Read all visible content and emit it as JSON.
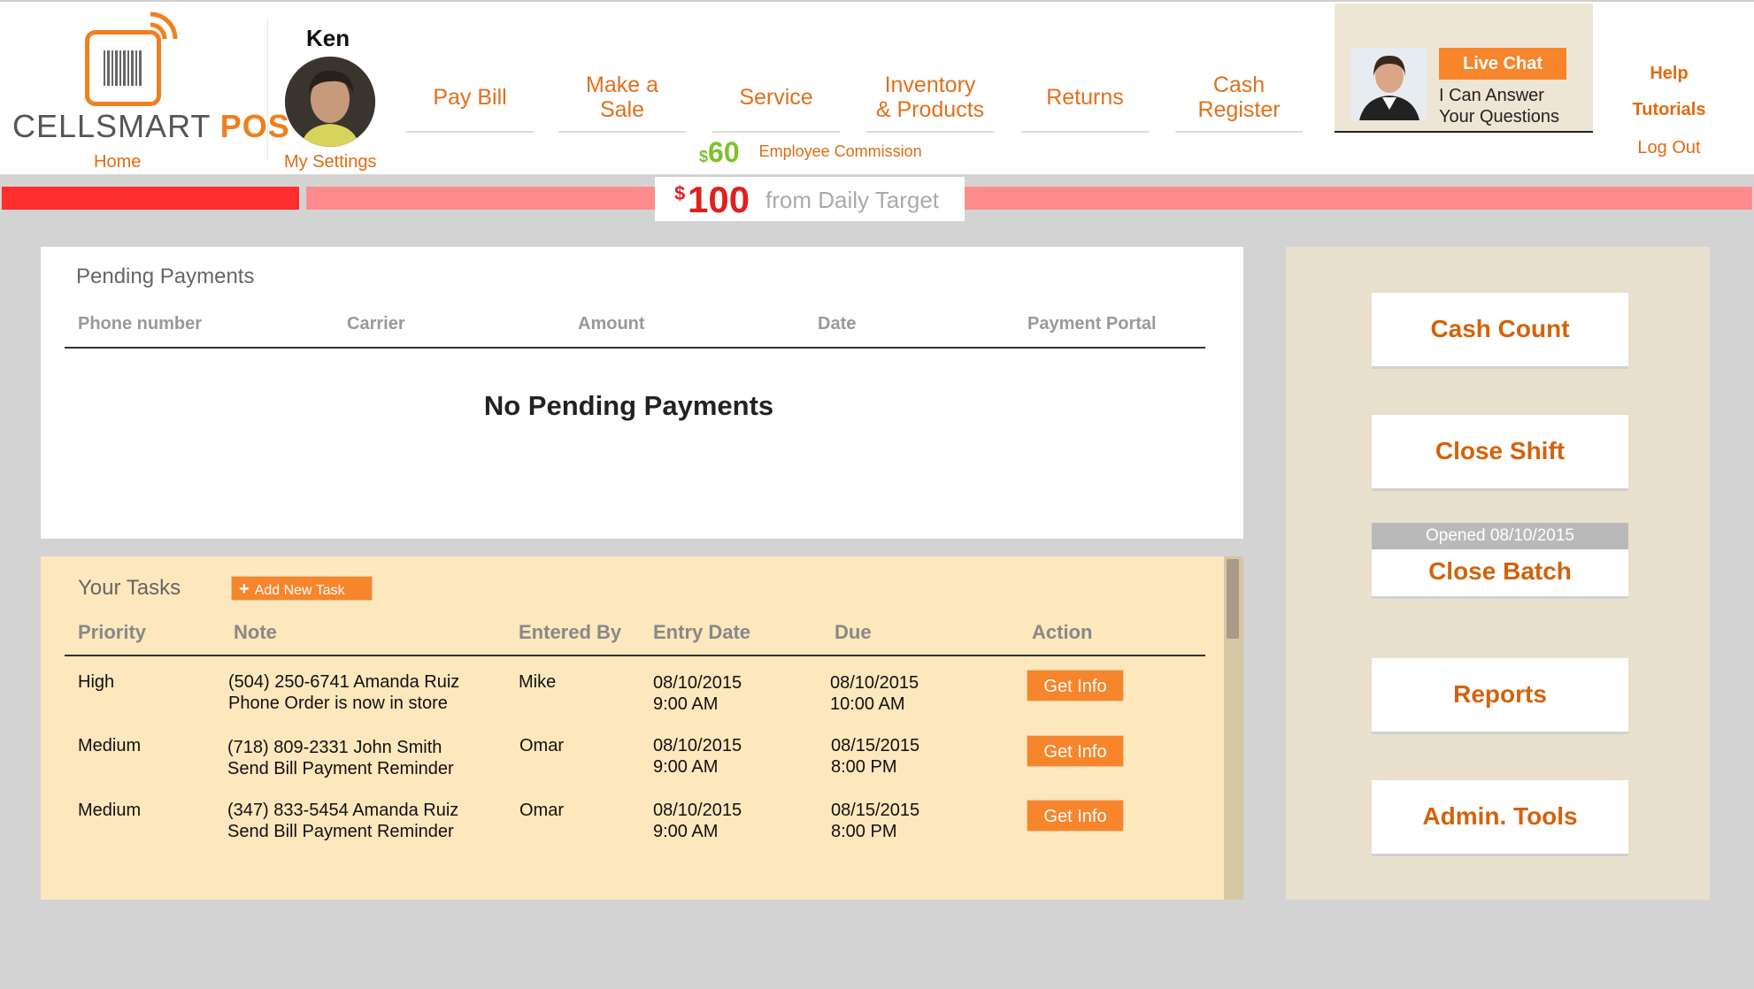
{
  "header": {
    "logo_text_main": "CELLSMART",
    "logo_text_accent": "POS",
    "home_label": "Home",
    "user_name": "Ken",
    "my_settings_label": "My Settings",
    "nav": [
      {
        "line1": "Pay Bill",
        "line2": ""
      },
      {
        "line1": "Make a",
        "line2": "Sale"
      },
      {
        "line1": "Service",
        "line2": ""
      },
      {
        "line1": "Inventory",
        "line2": "& Products"
      },
      {
        "line1": "Returns",
        "line2": ""
      },
      {
        "line1": "Cash",
        "line2": "Register"
      }
    ],
    "commission": {
      "currency": "$",
      "amount": "60",
      "label": "Employee Commission"
    },
    "live_chat": {
      "button": "Live Chat",
      "line1": "I Can Answer",
      "line2": "Your Questions"
    },
    "links": {
      "help": "Help",
      "tutorials": "Tutorials",
      "logout": "Log Out"
    }
  },
  "daily_target": {
    "currency": "$",
    "amount": "100",
    "label": "from Daily Target",
    "progress_fraction": 0.17
  },
  "pending_payments": {
    "title": "Pending Payments",
    "columns": [
      "Phone number",
      "Carrier",
      "Amount",
      "Date",
      "Payment Portal"
    ],
    "empty_message": "No Pending Payments"
  },
  "tasks": {
    "title": "Your Tasks",
    "add_button": "Add New Task",
    "columns": [
      "Priority",
      "Note",
      "Entered By",
      "Entry Date",
      "Due",
      "Action"
    ],
    "rows": [
      {
        "priority": "High",
        "note1": "(504) 250-6741 Amanda Ruiz",
        "note2": "Phone Order is now in store",
        "entered_by": "Mike",
        "entry_date": "08/10/2015",
        "entry_time": "9:00 AM",
        "due_date": "08/10/2015",
        "due_time": "10:00 AM",
        "action": "Get Info"
      },
      {
        "priority": "Medium",
        "note1": "(718) 809-2331 John Smith",
        "note2": "Send Bill Payment Reminder",
        "entered_by": "Omar",
        "entry_date": "08/10/2015",
        "entry_time": "9:00 AM",
        "due_date": "08/15/2015",
        "due_time": "8:00 PM",
        "action": "Get Info"
      },
      {
        "priority": "Medium",
        "note1": "(347) 833-5454 Amanda Ruiz",
        "note2": "Send Bill Payment Reminder",
        "entered_by": "Omar",
        "entry_date": "08/10/2015",
        "entry_time": "9:00 AM",
        "due_date": "08/15/2015",
        "due_time": "8:00 PM",
        "action": "Get Info"
      }
    ]
  },
  "side": {
    "cash_count": "Cash Count",
    "close_shift": "Close Shift",
    "batch_opened": "Opened 08/10/2015",
    "close_batch": "Close Batch",
    "reports": "Reports",
    "admin_tools": "Admin. Tools"
  },
  "colors": {
    "accent": "#f7852c",
    "brand_orange": "#e06b12",
    "commission_green": "#7cc229",
    "target_red": "#ff2d2d",
    "target_pink": "#ff8c8c"
  }
}
